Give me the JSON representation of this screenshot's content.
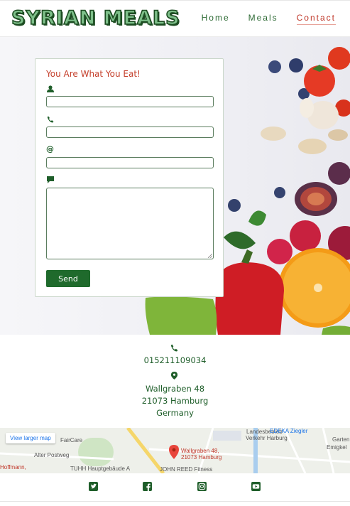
{
  "brand": {
    "logo": "SYRIAN MEALS"
  },
  "nav": {
    "items": [
      {
        "label": "Home"
      },
      {
        "label": "Meals"
      },
      {
        "label": "Contact",
        "active": true
      }
    ]
  },
  "form": {
    "title": "You Are What You Eat!",
    "fields": [
      {
        "icon": "user-icon",
        "value": ""
      },
      {
        "icon": "phone-icon",
        "value": ""
      },
      {
        "icon": "at-icon",
        "symbol": "@",
        "value": ""
      },
      {
        "icon": "comment-icon",
        "value": ""
      }
    ],
    "submit_label": "Send"
  },
  "contact": {
    "phone": "015211109034",
    "address_line1": "Wallgraben 48",
    "address_line2": "21073 Hamburg",
    "country": "Germany"
  },
  "map": {
    "link_label": "View larger map",
    "pin_label_line1": "Wallgraben 48,",
    "pin_label_line2": "21073 Hamburg",
    "labels": [
      "FairCare",
      "Alter Postweg",
      "Hoffmann,",
      "TUHH Hauptgebäude A",
      "JOHN REED Fitness",
      "Landesbetrieb",
      "Verkehr Harburg",
      "EDEKA Ziegler",
      "Garten",
      "Emigkel"
    ]
  },
  "footer": {
    "social": [
      "twitter-icon",
      "facebook-icon",
      "instagram-icon",
      "youtube-icon"
    ]
  },
  "colors": {
    "brand_green": "#1f5e2a",
    "accent_red": "#c43e2a",
    "button_green": "#1f6a2c"
  }
}
